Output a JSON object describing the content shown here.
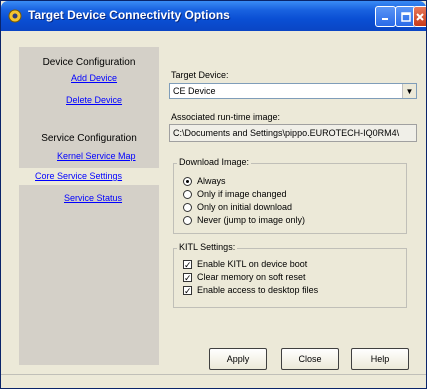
{
  "window": {
    "title": "Target Device Connectivity Options",
    "accent": "#0a4fd4",
    "icons": [
      "app-icon",
      "minimize-icon",
      "maximize-icon",
      "close-icon"
    ]
  },
  "sidebar": {
    "device_heading": "Device Configuration",
    "add_device": "Add Device",
    "delete_device": "Delete Device",
    "service_heading": "Service Configuration",
    "kernel_service_map": "Kernel Service Map",
    "core_service_settings": "Core Service Settings",
    "service_status": "Service Status",
    "selected_item": "Core Service Settings"
  },
  "main": {
    "target_device_label": "Target Device:",
    "target_device_value": "CE Device",
    "runtime_label": "Associated run-time image:",
    "runtime_value": "C:\\Documents and Settings\\pippo.EUROTECH-IQ0RM4\\",
    "download": {
      "title": "Download Image:",
      "options": [
        "Always",
        "Only if image changed",
        "Only on initial download",
        "Never (jump to image only)"
      ],
      "selected": "Always"
    },
    "kitl": {
      "title": "KITL Settings:",
      "options": [
        {
          "label": "Enable KITL on device boot",
          "checked": true
        },
        {
          "label": "Clear memory on soft reset",
          "checked": true
        },
        {
          "label": "Enable access to desktop files",
          "checked": true
        }
      ]
    }
  },
  "buttons": {
    "apply": "Apply",
    "close": "Close",
    "help": "Help"
  }
}
